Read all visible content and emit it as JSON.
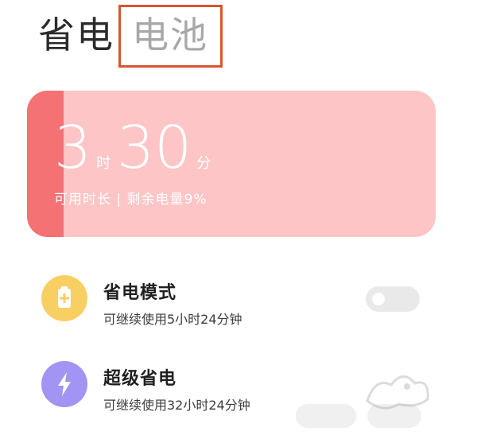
{
  "header": {
    "tabs": [
      {
        "label": "省电",
        "active": true
      },
      {
        "label": "电池",
        "active": false,
        "highlighted": true
      }
    ]
  },
  "battery": {
    "hours": "3",
    "hours_unit": "时",
    "minutes": "30",
    "minutes_unit": "分",
    "subtitle": "可用时长 | 剩余电量9%",
    "level_fraction": 0.09,
    "colors": {
      "card": "#fdc5c5",
      "level": "#f47174"
    }
  },
  "settings": [
    {
      "title": "省电模式",
      "desc": "可继续使用5小时24分钟",
      "icon": "battery-plus-icon",
      "icon_color": "#f8cf62",
      "toggle_on": false
    },
    {
      "title": "超级省电",
      "desc": "可继续使用32小时24分钟",
      "icon": "lightning-bolt-icon",
      "icon_color": "#a194f2",
      "toggle_on": false
    }
  ],
  "colors": {
    "highlight_box": "#d9552f",
    "tab_active": "#2b2b2b",
    "tab_inactive": "#a8a8a8"
  }
}
